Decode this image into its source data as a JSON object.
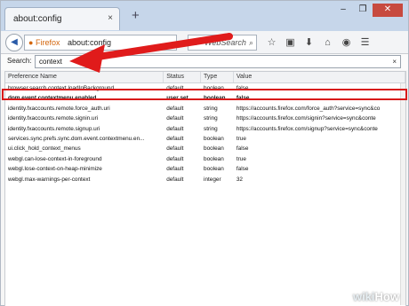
{
  "browser": {
    "tab_title": "about:config",
    "tab_close": "×",
    "new_tab": "+",
    "window_controls": [
      "–",
      "❐",
      "✕"
    ],
    "brand_label": "Firefox",
    "url": "about:config",
    "search_placeholder": "WebSearch",
    "search_engine_icon": "G",
    "search_icon": "⌕",
    "toolbar_icons": [
      "☆",
      "▣",
      "⬇",
      "⌂",
      "◉",
      "☰"
    ]
  },
  "config": {
    "search_label": "Search:",
    "search_value": "context",
    "clear": "×",
    "columns": [
      "Preference Name",
      "Status",
      "Type",
      "Value"
    ],
    "rows": [
      [
        "browser.search.context.loadInBackground",
        "default",
        "boolean",
        "false"
      ],
      [
        "dom.event.contextmenu.enabled",
        "user set",
        "boolean",
        "false"
      ],
      [
        "identity.fxaccounts.remote.force_auth.uri",
        "default",
        "string",
        "https://accounts.firefox.com/force_auth?service=sync&co"
      ],
      [
        "identity.fxaccounts.remote.signin.uri",
        "default",
        "string",
        "https://accounts.firefox.com/signin?service=sync&conte"
      ],
      [
        "identity.fxaccounts.remote.signup.uri",
        "default",
        "string",
        "https://accounts.firefox.com/signup?service=sync&conte"
      ],
      [
        "services.sync.prefs.sync.dom.event.contextmenu.en...",
        "default",
        "boolean",
        "true"
      ],
      [
        "ui.click_hold_context_menus",
        "default",
        "boolean",
        "false"
      ],
      [
        "webgl.can-lose-context-in-foreground",
        "default",
        "boolean",
        "true"
      ],
      [
        "webgl.lose-context-on-heap-minimize",
        "default",
        "boolean",
        "false"
      ],
      [
        "webgl.max-warnings-per-context",
        "default",
        "integer",
        "32"
      ]
    ]
  },
  "annotation": {
    "arrow_color": "#e01b1b",
    "highlight_color": "#d81b1b"
  },
  "watermark": {
    "wiki": "wiki",
    "how": "How"
  }
}
